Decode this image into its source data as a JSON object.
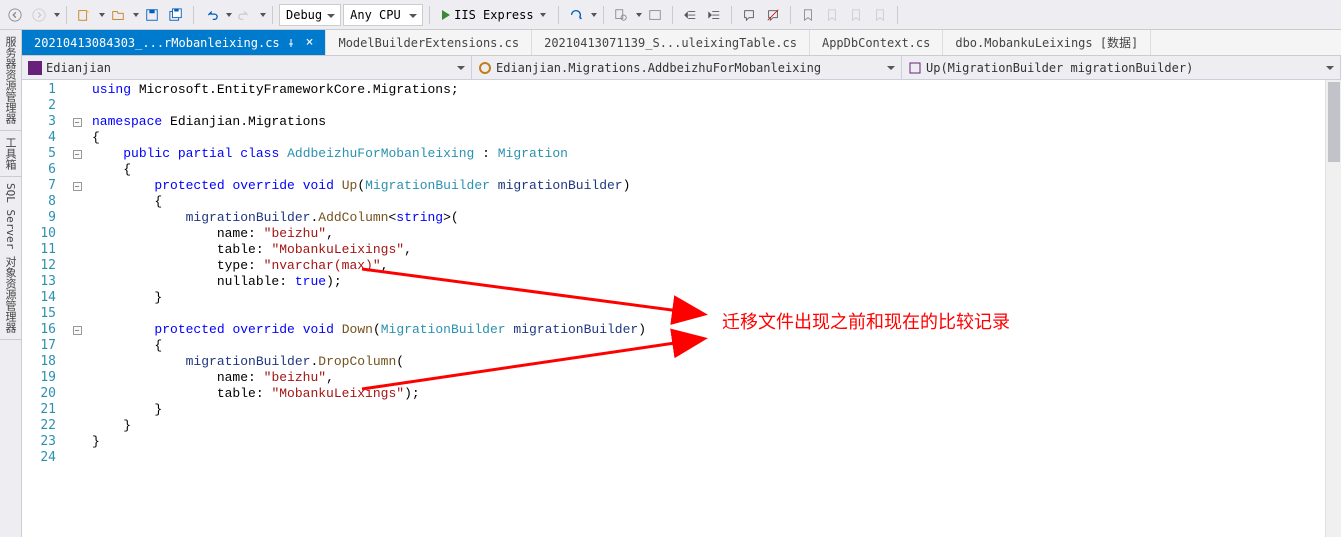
{
  "toolbar": {
    "config": "Debug",
    "platform": "Any CPU",
    "run_label": "IIS Express"
  },
  "side_tabs": [
    "服务器资源管理器",
    "工具箱",
    "SQL Server 对象资源管理器"
  ],
  "file_tabs": [
    {
      "label": "20210413084303_...rMobanleixing.cs",
      "active": true
    },
    {
      "label": "ModelBuilderExtensions.cs",
      "active": false
    },
    {
      "label": "20210413071139_S...uleixingTable.cs",
      "active": false
    },
    {
      "label": "AppDbContext.cs",
      "active": false
    },
    {
      "label": "dbo.MobankuLeixings [数据]",
      "active": false
    }
  ],
  "nav": {
    "project": "Edianjian",
    "class": "Edianjian.Migrations.AddbeizhuForMobanleixing",
    "member": "Up(MigrationBuilder migrationBuilder)"
  },
  "code": {
    "lines": [
      {
        "n": 1,
        "html": "<span class='kw'>using</span> Microsoft.EntityFrameworkCore.Migrations;"
      },
      {
        "n": 2,
        "html": ""
      },
      {
        "n": 3,
        "fold": "-",
        "html": "<span class='kw'>namespace</span> Edianjian.Migrations"
      },
      {
        "n": 4,
        "html": "{"
      },
      {
        "n": 5,
        "fold": "-",
        "html": "    <span class='kw'>public</span> <span class='kw'>partial</span> <span class='kw'>class</span> <span class='type'>AddbeizhuForMobanleixing</span> : <span class='type'>Migration</span>"
      },
      {
        "n": 6,
        "html": "    {"
      },
      {
        "n": 7,
        "fold": "-",
        "html": "        <span class='kw'>protected</span> <span class='kw'>override</span> <span class='kw'>void</span> <span class='method'>Up</span>(<span class='type'>MigrationBuilder</span> <span class='param'>migrationBuilder</span>)"
      },
      {
        "n": 8,
        "html": "        {"
      },
      {
        "n": 9,
        "html": "            <span class='param'>migrationBuilder</span>.<span class='method'>AddColumn</span>&lt;<span class='kw'>string</span>&gt;("
      },
      {
        "n": 10,
        "html": "                name: <span class='str'>\"beizhu\"</span>,"
      },
      {
        "n": 11,
        "html": "                table: <span class='str'>\"MobankuLeixings\"</span>,"
      },
      {
        "n": 12,
        "html": "                type: <span class='str'>\"nvarchar(max)\"</span>,"
      },
      {
        "n": 13,
        "html": "                nullable: <span class='kw'>true</span>);"
      },
      {
        "n": 14,
        "html": "        }"
      },
      {
        "n": 15,
        "html": ""
      },
      {
        "n": 16,
        "fold": "-",
        "html": "        <span class='kw'>protected</span> <span class='kw'>override</span> <span class='kw'>void</span> <span class='method'>Down</span>(<span class='type'>MigrationBuilder</span> <span class='param'>migrationBuilder</span>)"
      },
      {
        "n": 17,
        "html": "        {"
      },
      {
        "n": 18,
        "html": "            <span class='param'>migrationBuilder</span>.<span class='method'>DropColumn</span>("
      },
      {
        "n": 19,
        "html": "                name: <span class='str'>\"beizhu\"</span>,"
      },
      {
        "n": 20,
        "html": "                table: <span class='str'>\"MobankuLeixings\"</span>);"
      },
      {
        "n": 21,
        "html": "        }"
      },
      {
        "n": 22,
        "html": "    }"
      },
      {
        "n": 23,
        "html": "}"
      },
      {
        "n": 24,
        "html": ""
      }
    ]
  },
  "annotation": {
    "text": "迁移文件出现之前和现在的比较记录"
  }
}
